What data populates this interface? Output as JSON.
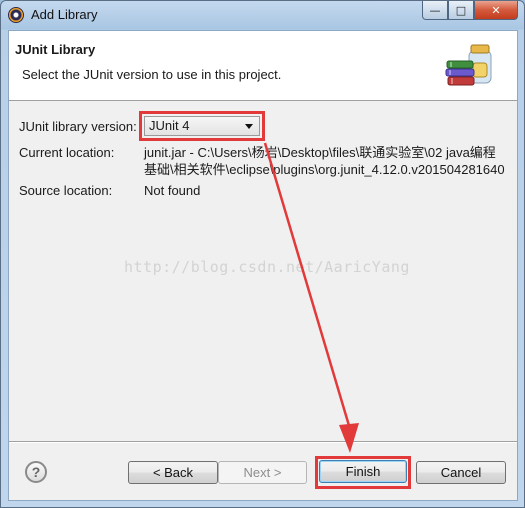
{
  "window": {
    "title": "Add Library",
    "minimize_glyph": "—",
    "maximize_glyph": "□",
    "close_glyph": "✕"
  },
  "banner": {
    "title": "JUnit Library",
    "description": "Select the JUnit version to use in this project.",
    "icon": "library-jars-icon"
  },
  "form": {
    "version_label": "JUnit library version:",
    "version_value": "JUnit 4",
    "location_label": "Current location:",
    "location_line1": "junit.jar - C:\\Users\\杨岩\\Desktop\\files\\联通实验室\\02 java编程",
    "location_line2": "基础\\相关软件\\eclipse\\plugins\\org.junit_4.12.0.v201504281640",
    "source_label": "Source location:",
    "source_value": "Not found"
  },
  "watermark": "http://blog.csdn.net/AaricYang",
  "buttons": {
    "help": "?",
    "back": "< Back",
    "next": "Next >",
    "finish": "Finish",
    "cancel": "Cancel"
  },
  "annotation": {
    "highlight_color": "#e23a3a"
  }
}
